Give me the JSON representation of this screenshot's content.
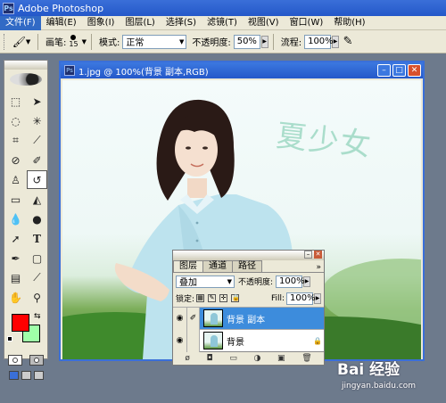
{
  "app": {
    "title": "Adobe Photoshop",
    "logo": "Ps"
  },
  "menu": [
    "文件(F)",
    "编辑(E)",
    "图象(I)",
    "图层(L)",
    "选择(S)",
    "滤镜(T)",
    "视图(V)",
    "窗口(W)",
    "帮助(H)"
  ],
  "options": {
    "brush_label": "画笔:",
    "brush_size": "15",
    "mode_label": "模式:",
    "mode_value": "正常",
    "opacity_label": "不透明度:",
    "opacity_value": "50%",
    "flow_label": "流程:",
    "flow_value": "100%"
  },
  "document": {
    "title": "1.jpg @ 100%(背景 副本,RGB)",
    "art_text": "夏少女"
  },
  "layers_panel": {
    "tabs": [
      "图层",
      "通道",
      "路径"
    ],
    "blend_mode": "叠加",
    "opacity_label": "不透明度:",
    "opacity_value": "100%",
    "lock_label": "锁定:",
    "fill_label": "Fill:",
    "fill_value": "100%",
    "layers": [
      {
        "name": "背景 副本",
        "selected": true
      },
      {
        "name": "背景",
        "selected": false
      }
    ]
  },
  "colors": {
    "foreground": "#ff0000",
    "background": "#9fffa8",
    "accent": "#3a6fd8"
  },
  "watermark": {
    "main": "Bai 经验",
    "sub": "jingyan.baidu.com"
  }
}
